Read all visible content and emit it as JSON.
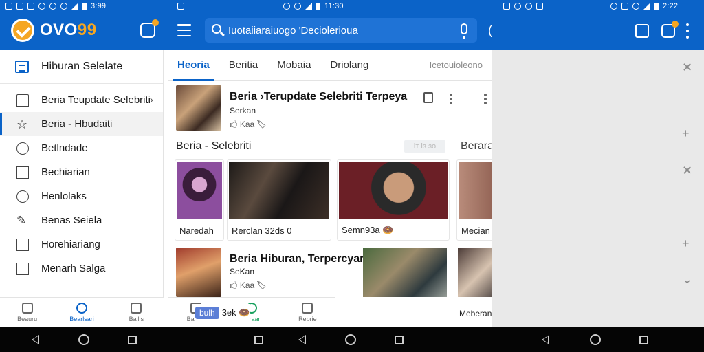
{
  "status_bar": {
    "time_left": "3:99",
    "time_mid": "11:30",
    "time_right": "2:22"
  },
  "app": {
    "logo_prefix": "OVO",
    "logo_suffix": "99"
  },
  "search": {
    "query": "Iuotaiiaraiuogo 'Deciolerioua"
  },
  "top_right": {
    "paren": "("
  },
  "drawer": {
    "header": "Hiburan Selelate",
    "items": [
      {
        "label": "Beria Teupdate Selebriti",
        "icon": "home-icon",
        "chevron": "›"
      },
      {
        "label": "Beria - Hbudaiti",
        "icon": "star-icon",
        "active": true
      },
      {
        "label": "Betlndade",
        "icon": "circle-icon"
      },
      {
        "label": "Bechiarian",
        "icon": "square-icon"
      },
      {
        "label": "Henlolaks",
        "icon": "circle-icon"
      },
      {
        "label": "Benas Seiela",
        "icon": "pen-icon"
      },
      {
        "label": "Horehiariang",
        "icon": "square-icon"
      },
      {
        "label": "Menarh Salga",
        "icon": "square-icon"
      }
    ]
  },
  "bottom_nav_left": [
    {
      "label": "Beauru",
      "icon": "grid-icon"
    },
    {
      "label": "Bearlsari",
      "icon": "chat-icon",
      "active": true
    },
    {
      "label": "Ballis",
      "icon": "tv-icon"
    }
  ],
  "bottom_nav_mid": [
    {
      "label": "Baaria",
      "icon": "grid-icon"
    },
    {
      "label": "Beraan",
      "icon": "circle-icon",
      "green": true
    },
    {
      "label": "Rebrie",
      "icon": "tv-icon"
    }
  ],
  "tabs": [
    {
      "label": "Heoria",
      "active": true
    },
    {
      "label": "Beritia"
    },
    {
      "label": "Mobaia"
    },
    {
      "label": "Driolang"
    },
    {
      "label": "Icetouioleono"
    }
  ],
  "top_article": {
    "title": "Beria ›Terupdate Selebriti Terpeya",
    "source": "Serkan",
    "meta": "🖒 Kaa 🏷"
  },
  "section": {
    "title": "Beria - Selebriti",
    "button": "lᴛ lɜ ɜo",
    "more": "Berara"
  },
  "media_cards": [
    {
      "caption": "Naredah"
    },
    {
      "caption": "Rerclan 32ds 0"
    },
    {
      "caption": "Semn93a 🍩"
    },
    {
      "caption": "Mecian"
    }
  ],
  "bottom_article": {
    "title": "Beria Hiburan, Terpercyar",
    "source": "SeKan",
    "meta": "🖒 Kaa 🏷",
    "pill": "bulh",
    "pill_caption": "3ek 🍩",
    "last_caption": "Meberan"
  }
}
